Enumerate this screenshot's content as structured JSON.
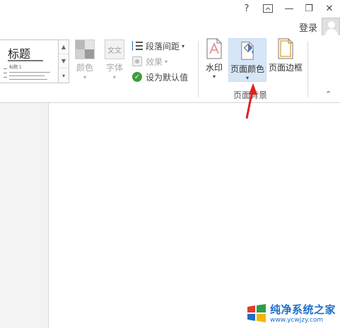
{
  "titlebar": {
    "help_label": "?",
    "ribbon_display_label": "⊼",
    "minimize_label": "—",
    "restore_label": "❐",
    "close_label": "✕",
    "login_label": "登录"
  },
  "styles_gallery": {
    "title_sample": "标题",
    "heading_sample": "标题 1"
  },
  "design": {
    "colors_label": "颜色",
    "fonts_label": "字体",
    "fonts_icon_text": "文文",
    "paragraph_spacing_label": "段落间距",
    "effects_label": "效果",
    "set_default_label": "设为默认值",
    "colors_icon_palette": [
      "#b9b9b9",
      "#e4e4e4",
      "#d2d2d2",
      "#9a9a9a"
    ]
  },
  "page_background": {
    "watermark_label": "水印",
    "page_color_label": "页面颜色",
    "page_borders_label": "页面边框",
    "group_label": "页面背景"
  },
  "watermark_logo": {
    "brand": "纯净系统之家",
    "url": "www.ycwjzy.com",
    "colors": [
      "#e23b2e",
      "#2e9d46",
      "#1f6fc8",
      "#f2b705"
    ]
  },
  "annotation": {
    "arrow_color": "#e02020"
  }
}
